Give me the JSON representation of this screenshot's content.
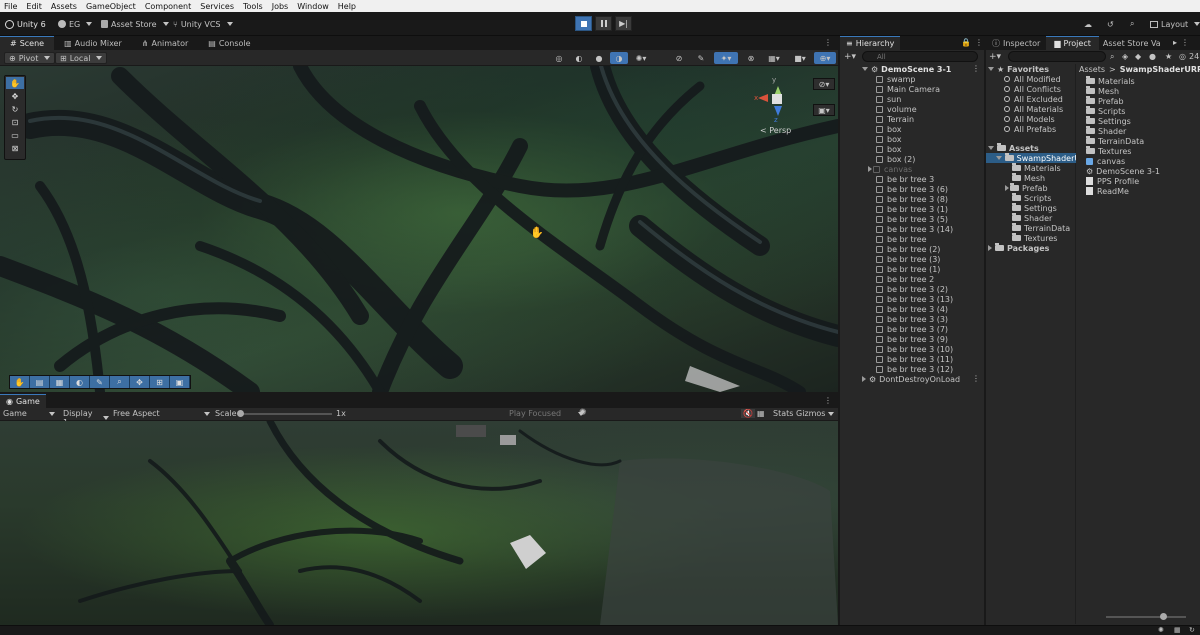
{
  "menu": [
    "File",
    "Edit",
    "Assets",
    "GameObject",
    "Component",
    "Services",
    "Tools",
    "Jobs",
    "Window",
    "Help"
  ],
  "toolbar": {
    "unity_label": "Unity 6",
    "account": "EG",
    "asset_store": "Asset Store",
    "vcs": "Unity VCS",
    "layout": "Layout"
  },
  "scene_tabs": [
    "Scene",
    "Audio Mixer",
    "Animator",
    "Console"
  ],
  "scene_bar": {
    "pivot": "Pivot",
    "local": "Local"
  },
  "gizmo": {
    "persp": "< Persp",
    "x": "x",
    "y": "y",
    "z": "z"
  },
  "game_tab": "Game",
  "game_bar": {
    "mode": "Game",
    "display": "Display 1",
    "aspect": "Free Aspect",
    "scale_label": "Scale",
    "scale_value": "1x",
    "play_focused": "Play Focused",
    "stats": "Stats",
    "gizmos": "Gizmos"
  },
  "hierarchy": {
    "title": "Hierarchy",
    "search_placeholder": "All",
    "scene": "DemoScene 3-1",
    "items": [
      "swamp",
      "Main Camera",
      "sun",
      "volume",
      "Terrain",
      "box",
      "box",
      "box",
      "box (2)",
      "canvas",
      "be br tree 3",
      "be br tree 3 (6)",
      "be br tree 3 (8)",
      "be br tree 3 (1)",
      "be br tree 3 (5)",
      "be br tree 3 (14)",
      "be br tree",
      "be br tree (2)",
      "be br tree (3)",
      "be br tree (1)",
      "be br tree 2",
      "be br tree 3 (2)",
      "be br tree 3 (13)",
      "be br tree 3 (4)",
      "be br tree 3 (3)",
      "be br tree 3 (7)",
      "be br tree 3 (9)",
      "be br tree 3 (10)",
      "be br tree 3 (11)",
      "be br tree 3 (12)"
    ],
    "dont_destroy": "DontDestroyOnLoad"
  },
  "right_tabs": [
    "Inspector",
    "Project",
    "Asset Store Va"
  ],
  "project": {
    "favorites_label": "Favorites",
    "favorites": [
      "All Modified",
      "All Conflicts",
      "All Excluded",
      "All Materials",
      "All Models",
      "All Prefabs"
    ],
    "assets_label": "Assets",
    "selected_folder": "SwampShaderURP",
    "subfolders": [
      "Materials",
      "Mesh",
      "Prefab",
      "Scripts",
      "Settings",
      "Shader",
      "TerrainData",
      "Textures"
    ],
    "packages_label": "Packages",
    "breadcrumb_root": "Assets",
    "breadcrumb_current": "SwampShaderURP",
    "hidden_count": "24",
    "contents": [
      {
        "name": "Materials",
        "kind": "folder"
      },
      {
        "name": "Mesh",
        "kind": "folder"
      },
      {
        "name": "Prefab",
        "kind": "folder"
      },
      {
        "name": "Scripts",
        "kind": "folder"
      },
      {
        "name": "Settings",
        "kind": "folder"
      },
      {
        "name": "Shader",
        "kind": "folder"
      },
      {
        "name": "TerrainData",
        "kind": "folder"
      },
      {
        "name": "Textures",
        "kind": "folder"
      },
      {
        "name": "canvas",
        "kind": "prefab"
      },
      {
        "name": "DemoScene 3-1",
        "kind": "scene"
      },
      {
        "name": "PPS Profile",
        "kind": "asset"
      },
      {
        "name": "ReadMe",
        "kind": "asset"
      }
    ]
  },
  "colors": {
    "accent": "#3a79bb",
    "panel": "#282828",
    "background": "#191919"
  }
}
